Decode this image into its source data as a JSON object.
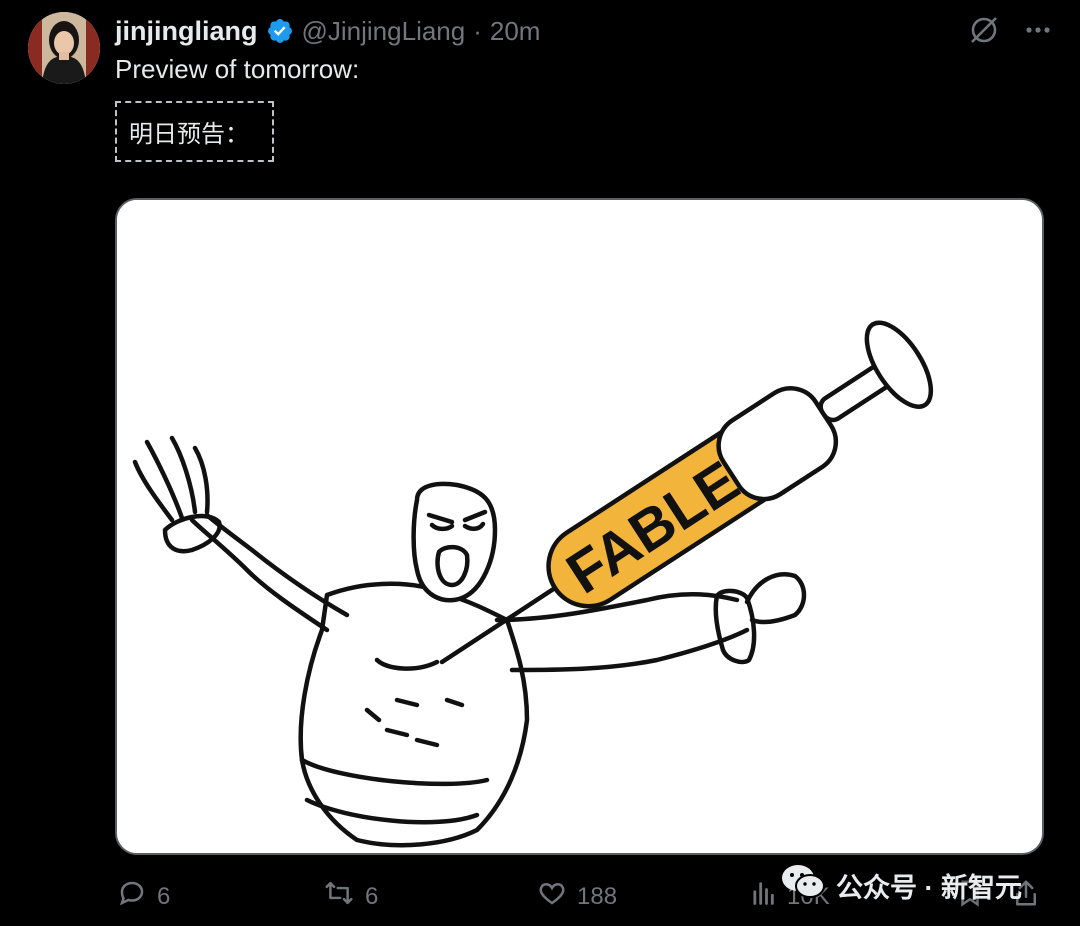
{
  "tweet": {
    "display_name": "jinjingliang",
    "handle": "@JinjingLiang",
    "separator": "·",
    "time": "20m",
    "text": "Preview of tomorrow:",
    "translation": "明日预告："
  },
  "media": {
    "syringe_label": "FABLE",
    "colors": {
      "syringe_fill": "#f2b43a",
      "line": "#111111",
      "background": "#ffffff"
    }
  },
  "actions": {
    "replies": "6",
    "reposts": "6",
    "likes": "188",
    "views": "10K"
  },
  "watermark": {
    "text": "公众号 · 新智元"
  },
  "icons": {
    "verified": "verified-badge-icon",
    "grok": "grok-icon",
    "more": "more-icon",
    "reply": "reply-icon",
    "repost": "repost-icon",
    "like": "heart-icon",
    "views": "views-icon",
    "bookmark": "bookmark-icon",
    "share": "share-icon",
    "wechat": "wechat-icon"
  },
  "colors": {
    "background": "#000000",
    "text": "#e7e9ea",
    "muted": "#71767b",
    "verified": "#1d9bf0"
  }
}
